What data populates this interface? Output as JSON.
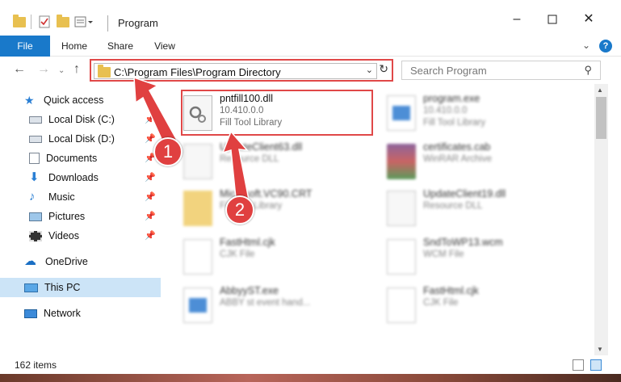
{
  "window": {
    "title": "Program",
    "minimize_icon": "minimize-icon",
    "maximize_icon": "maximize-icon",
    "close_icon": "close-icon"
  },
  "ribbon": {
    "tabs": [
      "File",
      "Home",
      "Share",
      "View"
    ],
    "help": "?"
  },
  "nav": {
    "address": "C:\\Program Files\\Program Directory",
    "search_placeholder": "Search Program"
  },
  "sidebar": {
    "items": [
      {
        "label": "Quick access",
        "icon": "star-icon",
        "pinned": false
      },
      {
        "label": "Local Disk (C:)",
        "icon": "drive-icon",
        "pinned": true
      },
      {
        "label": "Local Disk (D:)",
        "icon": "drive-icon",
        "pinned": true
      },
      {
        "label": "Documents",
        "icon": "documents-icon",
        "pinned": true
      },
      {
        "label": "Downloads",
        "icon": "download-icon",
        "pinned": true
      },
      {
        "label": "Music",
        "icon": "music-icon",
        "pinned": true
      },
      {
        "label": "Pictures",
        "icon": "pictures-icon",
        "pinned": true
      },
      {
        "label": "Videos",
        "icon": "videos-icon",
        "pinned": true
      },
      {
        "label": "OneDrive",
        "icon": "cloud-icon",
        "pinned": false
      },
      {
        "label": "This PC",
        "icon": "computer-icon",
        "pinned": false
      },
      {
        "label": "Network",
        "icon": "network-icon",
        "pinned": false
      }
    ]
  },
  "files": [
    {
      "name": "pntfill100.dll",
      "line2": "10.410.0.0",
      "line3": "Fill Tool Library",
      "icon": "dll-file-icon"
    },
    {
      "name": "program.exe",
      "line2": "10.410.0.0",
      "line3": "Fill Tool Library",
      "icon": "exe-file-icon"
    },
    {
      "name": "UpdateClient63.dll",
      "line2": "Resource DLL",
      "line3": "",
      "icon": "dll-file-icon"
    },
    {
      "name": "certificates.cab",
      "line2": "WinRAR Archive",
      "line3": "",
      "icon": "archive-file-icon"
    },
    {
      "name": "Microsoft.VC90.CRT",
      "line2": "Fill Tool Library",
      "line3": "",
      "icon": "folder-icon"
    },
    {
      "name": "UpdateClient19.dll",
      "line2": "Resource DLL",
      "line3": "",
      "icon": "dll-file-icon"
    },
    {
      "name": "FastHtml.cjk",
      "line2": "CJK File",
      "line3": "",
      "icon": "file-icon"
    },
    {
      "name": "SndToWP13.wcm",
      "line2": "WCM File",
      "line3": "",
      "icon": "file-icon"
    },
    {
      "name": "AbbyyST.exe",
      "line2": "ABBY st event hand...",
      "line3": "",
      "icon": "exe-file-icon"
    },
    {
      "name": "FastHtml.cjk",
      "line2": "CJK File",
      "line3": "",
      "icon": "file-icon"
    }
  ],
  "status": {
    "count": "162 items"
  },
  "annotations": {
    "step1": "1",
    "step2": "2",
    "color": "#e04040"
  }
}
